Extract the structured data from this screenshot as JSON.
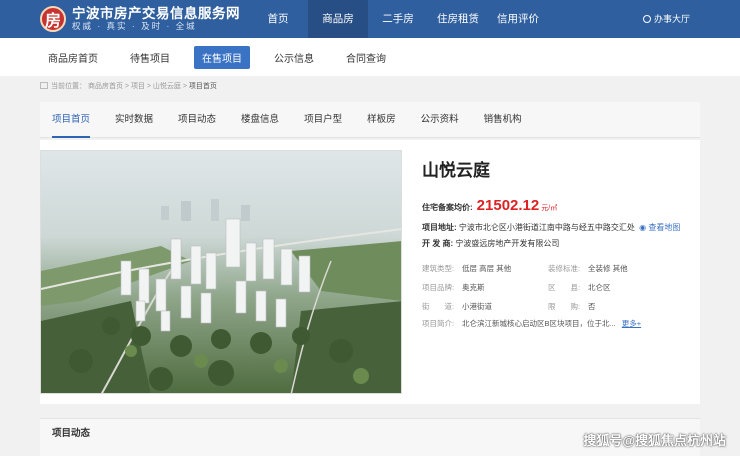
{
  "header": {
    "logo_char": "房",
    "site_title": "宁波市房产交易信息服务网",
    "slogan": "权威 · 真实 · 及时 · 全城",
    "nav": [
      "首页",
      "商品房",
      "二手房",
      "住房租赁",
      "信用评价"
    ],
    "active_nav": "商品房",
    "office_label": "办事大厅"
  },
  "subnav": {
    "items": [
      "商品房首页",
      "待售项目",
      "在售项目",
      "公示信息",
      "合同查询"
    ],
    "active": "在售项目"
  },
  "breadcrumb": {
    "prefix": "当前位置：",
    "items": [
      "商品房首页",
      "项目",
      "山悦云庭"
    ],
    "current": "项目首页"
  },
  "tabs": {
    "items": [
      "项目首页",
      "实时数据",
      "项目动态",
      "楼盘信息",
      "项目户型",
      "样板房",
      "公示资料",
      "销售机构"
    ],
    "active": "项目首页"
  },
  "project": {
    "name": "山悦云庭",
    "price_label": "住宅备案均价:",
    "price": "21502.12",
    "price_unit": "元/㎡",
    "address_label": "项目地址:",
    "address": "宁波市北仑区小港街道江南中路与经五中路交汇处",
    "map_link": "查看地图",
    "developer_label": "开 发 商:",
    "developer": "宁波盛远房地产开发有限公司",
    "building_type_label": "建筑类型:",
    "building_type": "低层 高层 其他",
    "decoration_label": "装修标准:",
    "decoration": "全装修 其他",
    "brand_label": "项目品牌:",
    "brand": "奥克斯",
    "district_label": "区　　县:",
    "district": "北仑区",
    "street_label": "街　　道:",
    "street": "小港街道",
    "purchase_label": "限　　购:",
    "purchase": "否",
    "intro_label": "项目简介:",
    "intro": "北仑滨江新城核心启动区B区块项目，位于北...",
    "more_link": "更多+"
  },
  "dynamics": {
    "title": "项目动态"
  },
  "watermark": "搜狐号@搜狐焦点杭州站",
  "colors": {
    "header_bg": "#2f5f9e",
    "accent": "#3b73c4",
    "price": "#d22222"
  }
}
